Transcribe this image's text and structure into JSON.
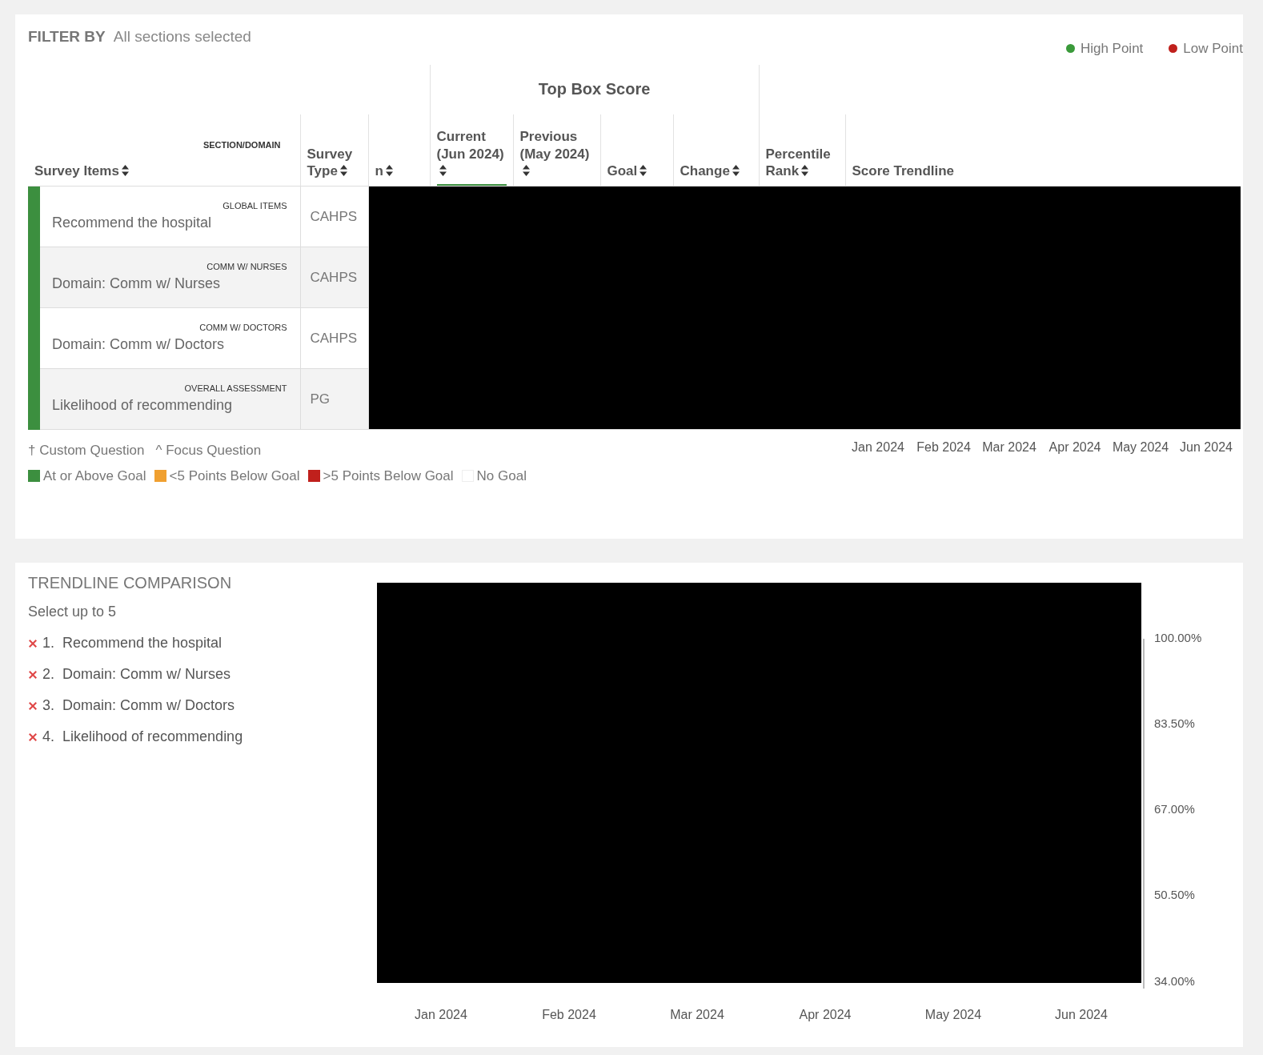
{
  "filter": {
    "label": "FILTER BY",
    "value": "All sections selected"
  },
  "point_legend": [
    {
      "label": "High Point",
      "color": "#3a9a3a"
    },
    {
      "label": "Low Point",
      "color": "#c0201c"
    }
  ],
  "table": {
    "group_header": "Top Box Score",
    "section_header": "SECTION/DOMAIN",
    "columns": [
      {
        "label": "Survey Items",
        "sortable": true,
        "sorted": false
      },
      {
        "label": "Survey Type",
        "sortable": true,
        "sorted": false
      },
      {
        "label": "n",
        "sortable": true,
        "sorted": false
      },
      {
        "label": "Current (Jun 2024)",
        "sortable": true,
        "sorted": true
      },
      {
        "label": "Previous (May 2024)",
        "sortable": true,
        "sorted": false
      },
      {
        "label": "Goal",
        "sortable": true,
        "sorted": false
      },
      {
        "label": "Change",
        "sortable": true,
        "sorted": false
      },
      {
        "label": "Percentile Rank",
        "sortable": true,
        "sorted": false
      },
      {
        "label": "Score Trendline",
        "sortable": false,
        "sorted": false
      }
    ],
    "rows": [
      {
        "section": "GLOBAL ITEMS",
        "item": "Recommend the hospital",
        "survey_type": "CAHPS",
        "color": "#3c8f3f"
      },
      {
        "section": "COMM W/ NURSES",
        "item": "Domain: Comm w/ Nurses",
        "survey_type": "CAHPS",
        "color": "#3c8f3f"
      },
      {
        "section": "COMM W/ DOCTORS",
        "item": "Domain: Comm w/ Doctors",
        "survey_type": "CAHPS",
        "color": "#3c8f3f"
      },
      {
        "section": "OVERALL ASSESSMENT",
        "item": "Likelihood of recommending",
        "survey_type": "PG",
        "color": "#3c8f3f"
      }
    ],
    "trend_months": [
      "Jan 2024",
      "Feb 2024",
      "Mar 2024",
      "Apr 2024",
      "May 2024",
      "Jun 2024"
    ]
  },
  "notes": [
    "† Custom Question",
    "^ Focus Question"
  ],
  "goal_legend": [
    {
      "label": "At or Above Goal",
      "color": "#3c8f3f"
    },
    {
      "label": "<5 Points Below Goal",
      "color": "#f0a030"
    },
    {
      "label": ">5 Points Below Goal",
      "color": "#c0201c"
    },
    {
      "label": "No Goal",
      "color": "#ffffff"
    }
  ],
  "trendline": {
    "title": "TRENDLINE COMPARISON",
    "hint": "Select up to 5",
    "items": [
      {
        "number": "1.",
        "label": "Recommend the hospital"
      },
      {
        "number": "2.",
        "label": "Domain: Comm w/ Nurses"
      },
      {
        "number": "3.",
        "label": "Domain: Comm w/ Doctors"
      },
      {
        "number": "4.",
        "label": "Likelihood of recommending"
      }
    ],
    "y_axis_labels": [
      "100.00%",
      "83.50%",
      "67.00%",
      "50.50%",
      "34.00%"
    ],
    "x_axis_labels": [
      "Jan 2024",
      "Feb 2024",
      "Mar 2024",
      "Apr 2024",
      "May 2024",
      "Jun 2024"
    ]
  }
}
